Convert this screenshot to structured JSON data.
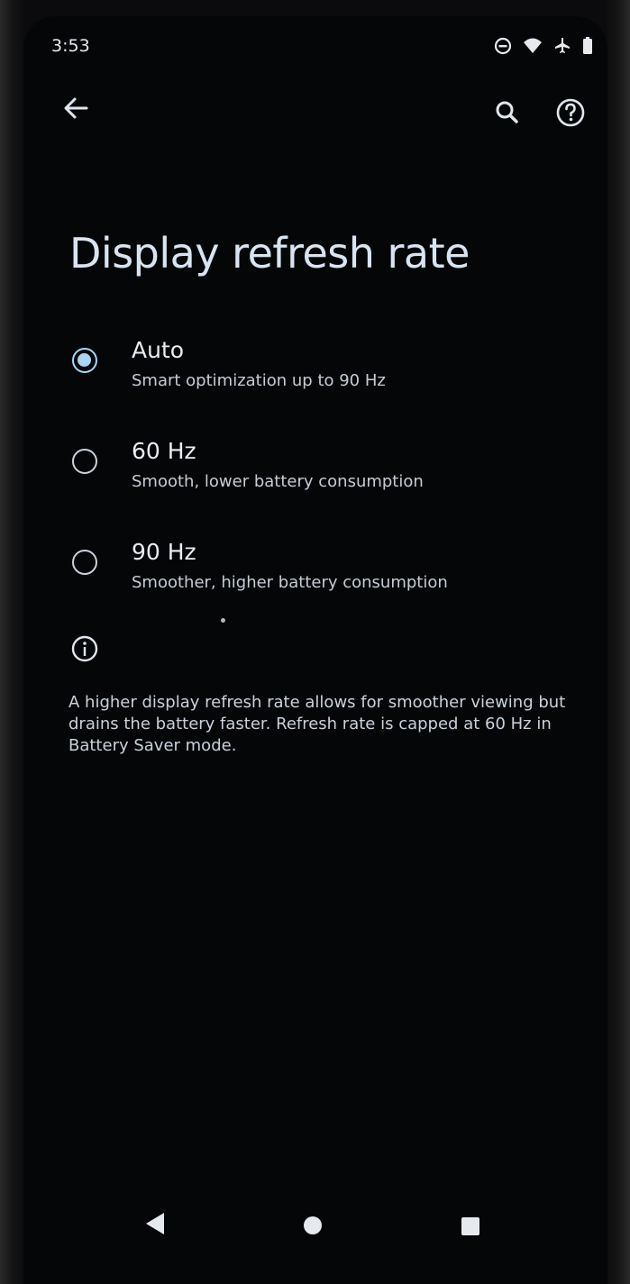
{
  "status_bar": {
    "time": "3:53",
    "icons": [
      "dnd-icon",
      "wifi-icon",
      "airplane-icon",
      "battery-icon"
    ]
  },
  "toolbar": {
    "back_icon": "back-arrow-icon",
    "search_icon": "search-icon",
    "help_icon": "help-icon"
  },
  "page": {
    "title": "Display refresh rate"
  },
  "options": [
    {
      "title": "Auto",
      "subtitle": "Smart optimization up to 90 Hz",
      "selected": true
    },
    {
      "title": "60 Hz",
      "subtitle": "Smooth, lower battery consumption",
      "selected": false
    },
    {
      "title": "90 Hz",
      "subtitle": "Smoother, higher battery consumption",
      "selected": false
    }
  ],
  "info": {
    "icon": "info-icon",
    "text": "A higher display refresh rate allows for smoother viewing but drains the battery faster. Refresh rate is capped at 60 Hz in Battery Saver mode."
  },
  "nav_bar": {
    "back_icon": "nav-back-icon",
    "home_icon": "nav-home-icon",
    "recents_icon": "nav-recents-icon"
  },
  "colors": {
    "background": "#050608",
    "accent": "#a9d4f5",
    "text_primary": "#e9edf2",
    "text_secondary": "#c5ccd5"
  }
}
